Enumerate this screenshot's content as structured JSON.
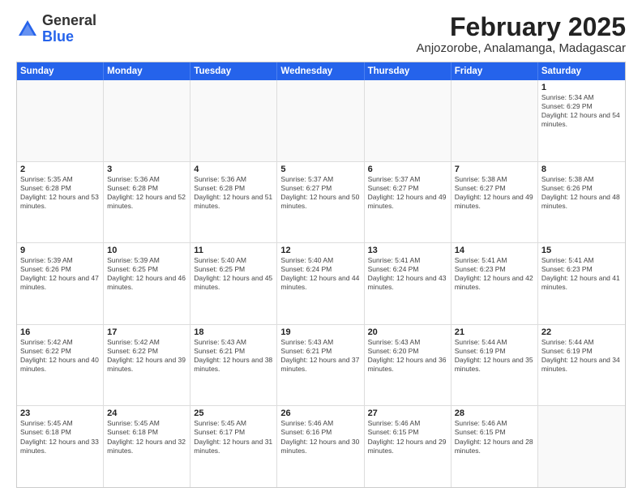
{
  "logo": {
    "general": "General",
    "blue": "Blue"
  },
  "title": "February 2025",
  "subtitle": "Anjozorobe, Analamanga, Madagascar",
  "days": [
    "Sunday",
    "Monday",
    "Tuesday",
    "Wednesday",
    "Thursday",
    "Friday",
    "Saturday"
  ],
  "weeks": [
    [
      {
        "day": "",
        "content": ""
      },
      {
        "day": "",
        "content": ""
      },
      {
        "day": "",
        "content": ""
      },
      {
        "day": "",
        "content": ""
      },
      {
        "day": "",
        "content": ""
      },
      {
        "day": "",
        "content": ""
      },
      {
        "day": "1",
        "content": "Sunrise: 5:34 AM\nSunset: 6:29 PM\nDaylight: 12 hours and 54 minutes."
      }
    ],
    [
      {
        "day": "2",
        "content": "Sunrise: 5:35 AM\nSunset: 6:28 PM\nDaylight: 12 hours and 53 minutes."
      },
      {
        "day": "3",
        "content": "Sunrise: 5:36 AM\nSunset: 6:28 PM\nDaylight: 12 hours and 52 minutes."
      },
      {
        "day": "4",
        "content": "Sunrise: 5:36 AM\nSunset: 6:28 PM\nDaylight: 12 hours and 51 minutes."
      },
      {
        "day": "5",
        "content": "Sunrise: 5:37 AM\nSunset: 6:27 PM\nDaylight: 12 hours and 50 minutes."
      },
      {
        "day": "6",
        "content": "Sunrise: 5:37 AM\nSunset: 6:27 PM\nDaylight: 12 hours and 49 minutes."
      },
      {
        "day": "7",
        "content": "Sunrise: 5:38 AM\nSunset: 6:27 PM\nDaylight: 12 hours and 49 minutes."
      },
      {
        "day": "8",
        "content": "Sunrise: 5:38 AM\nSunset: 6:26 PM\nDaylight: 12 hours and 48 minutes."
      }
    ],
    [
      {
        "day": "9",
        "content": "Sunrise: 5:39 AM\nSunset: 6:26 PM\nDaylight: 12 hours and 47 minutes."
      },
      {
        "day": "10",
        "content": "Sunrise: 5:39 AM\nSunset: 6:25 PM\nDaylight: 12 hours and 46 minutes."
      },
      {
        "day": "11",
        "content": "Sunrise: 5:40 AM\nSunset: 6:25 PM\nDaylight: 12 hours and 45 minutes."
      },
      {
        "day": "12",
        "content": "Sunrise: 5:40 AM\nSunset: 6:24 PM\nDaylight: 12 hours and 44 minutes."
      },
      {
        "day": "13",
        "content": "Sunrise: 5:41 AM\nSunset: 6:24 PM\nDaylight: 12 hours and 43 minutes."
      },
      {
        "day": "14",
        "content": "Sunrise: 5:41 AM\nSunset: 6:23 PM\nDaylight: 12 hours and 42 minutes."
      },
      {
        "day": "15",
        "content": "Sunrise: 5:41 AM\nSunset: 6:23 PM\nDaylight: 12 hours and 41 minutes."
      }
    ],
    [
      {
        "day": "16",
        "content": "Sunrise: 5:42 AM\nSunset: 6:22 PM\nDaylight: 12 hours and 40 minutes."
      },
      {
        "day": "17",
        "content": "Sunrise: 5:42 AM\nSunset: 6:22 PM\nDaylight: 12 hours and 39 minutes."
      },
      {
        "day": "18",
        "content": "Sunrise: 5:43 AM\nSunset: 6:21 PM\nDaylight: 12 hours and 38 minutes."
      },
      {
        "day": "19",
        "content": "Sunrise: 5:43 AM\nSunset: 6:21 PM\nDaylight: 12 hours and 37 minutes."
      },
      {
        "day": "20",
        "content": "Sunrise: 5:43 AM\nSunset: 6:20 PM\nDaylight: 12 hours and 36 minutes."
      },
      {
        "day": "21",
        "content": "Sunrise: 5:44 AM\nSunset: 6:19 PM\nDaylight: 12 hours and 35 minutes."
      },
      {
        "day": "22",
        "content": "Sunrise: 5:44 AM\nSunset: 6:19 PM\nDaylight: 12 hours and 34 minutes."
      }
    ],
    [
      {
        "day": "23",
        "content": "Sunrise: 5:45 AM\nSunset: 6:18 PM\nDaylight: 12 hours and 33 minutes."
      },
      {
        "day": "24",
        "content": "Sunrise: 5:45 AM\nSunset: 6:18 PM\nDaylight: 12 hours and 32 minutes."
      },
      {
        "day": "25",
        "content": "Sunrise: 5:45 AM\nSunset: 6:17 PM\nDaylight: 12 hours and 31 minutes."
      },
      {
        "day": "26",
        "content": "Sunrise: 5:46 AM\nSunset: 6:16 PM\nDaylight: 12 hours and 30 minutes."
      },
      {
        "day": "27",
        "content": "Sunrise: 5:46 AM\nSunset: 6:15 PM\nDaylight: 12 hours and 29 minutes."
      },
      {
        "day": "28",
        "content": "Sunrise: 5:46 AM\nSunset: 6:15 PM\nDaylight: 12 hours and 28 minutes."
      },
      {
        "day": "",
        "content": ""
      }
    ]
  ]
}
